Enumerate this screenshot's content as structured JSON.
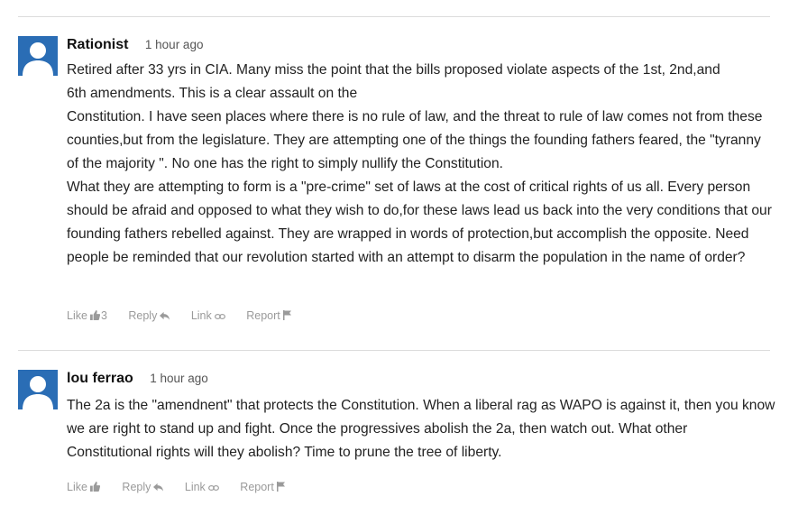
{
  "comments": [
    {
      "author": "Rationist",
      "time": "1 hour ago",
      "paragraphs": [
        "Retired after 33 yrs in CIA. Many miss the point that the bills proposed violate aspects of the 1st, 2nd,and 6th amendments. This is a clear assault on the",
        "Constitution.  I have seen places where there is no rule of law, and the threat to rule of law comes not from these counties,but from the legislature. They are attempting one of the things the founding fathers feared, the \"tyranny of the majority \". No one has the right to simply nullify the Constitution.",
        "What they are attempting to form is a \"pre-crime\" set of laws at the cost of critical rights of us all. Every person should be afraid and opposed to what they wish to do,for these laws lead us back into the very conditions that our founding fathers rebelled against. They are wrapped in words of protection,but accomplish the opposite. Need people be reminded that our revolution started with an attempt to disarm the population in the name of order?"
      ],
      "actions": {
        "like": "Like",
        "like_count": "3",
        "reply": "Reply",
        "link": "Link",
        "report": "Report"
      }
    },
    {
      "author": "lou ferrao",
      "time": "1 hour ago",
      "paragraphs": [
        "The 2a is the \"amendnent\" that protects the Constitution.  When a liberal rag as WAPO is against it, then you know we are right to stand up and fight. Once the progressives abolish the 2a, then watch out. What other Constitutional rights will they abolish? Time to prune the tree of liberty."
      ],
      "actions": {
        "like": "Like",
        "like_count": "",
        "reply": "Reply",
        "link": "Link",
        "report": "Report"
      }
    }
  ],
  "icons": {
    "avatar": "user-silhouette-icon",
    "like": "thumbs-up-icon",
    "reply": "reply-arrow-icon",
    "link": "chain-link-icon",
    "report": "flag-icon"
  },
  "colors": {
    "avatar_bg": "#2a6db5",
    "action_text": "#9a9a9a",
    "divider": "#dcdcdc"
  }
}
